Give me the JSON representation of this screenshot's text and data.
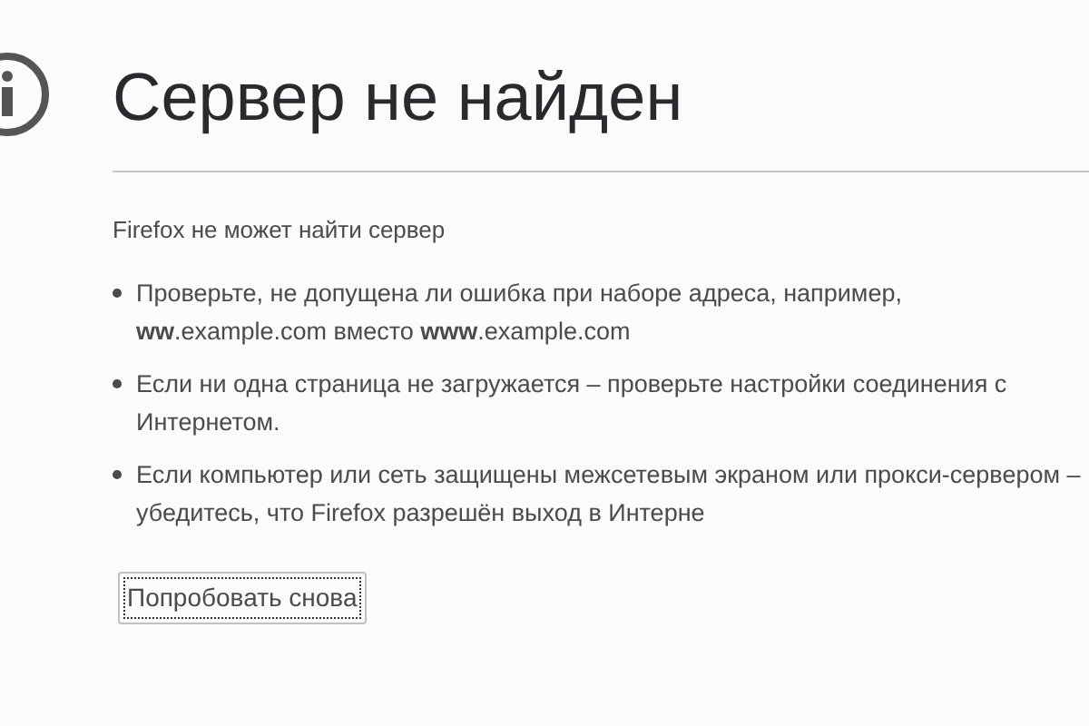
{
  "title": "Сервер не найден",
  "subtitle": "Firefox не может найти сервер",
  "bullets": [
    "Проверьте, не допущена ли ошибка при наборе адреса, например, **ww**.example.com вместо **www**.example.com",
    "Если ни одна страница не загружается – проверьте настройки соединения с Интернетом.",
    "Если компьютер или сеть защищены межсетевым экраном или прокси-сервером – убедитесь, что Firefox разрешён выход в Интерне"
  ],
  "button": "Попробовать снова"
}
